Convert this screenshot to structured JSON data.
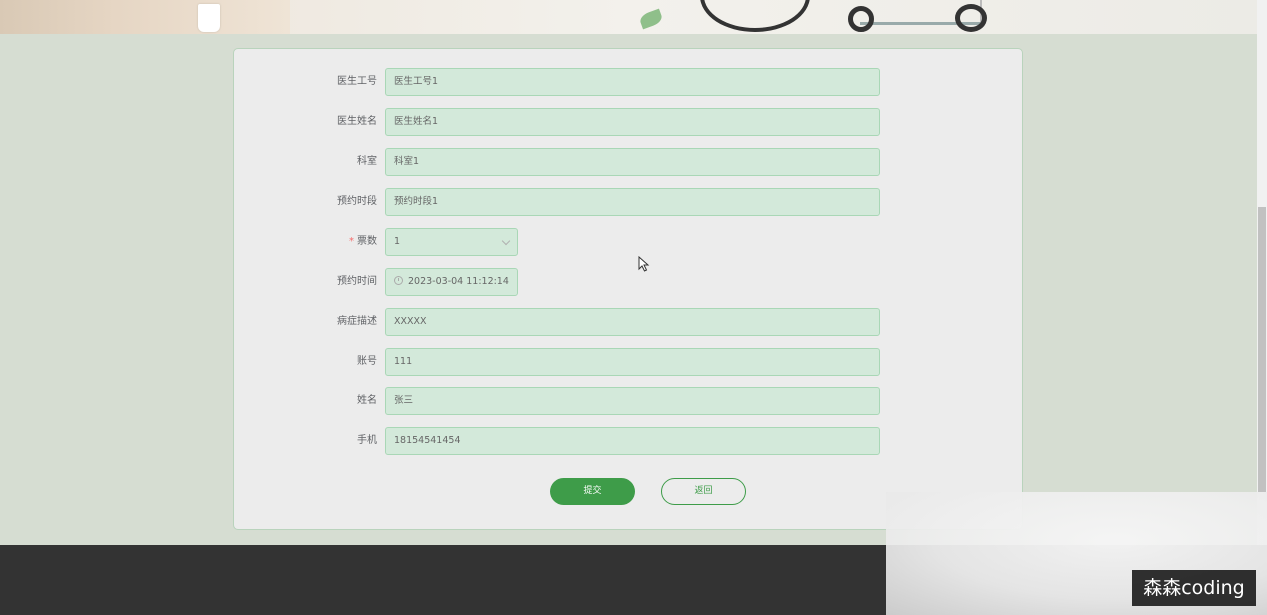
{
  "form": {
    "fields": [
      {
        "label": "医生工号",
        "value": "医生工号1"
      },
      {
        "label": "医生姓名",
        "value": "医生姓名1"
      },
      {
        "label": "科室",
        "value": "科室1"
      },
      {
        "label": "预约时段",
        "value": "预约时段1"
      },
      {
        "label": "票数",
        "value": "1",
        "required": true,
        "type": "select"
      },
      {
        "label": "预约时间",
        "value": "2023-03-04 11:12:14",
        "type": "datetime"
      },
      {
        "label": "病症描述",
        "value": "XXXXX"
      },
      {
        "label": "账号",
        "value": "111"
      },
      {
        "label": "姓名",
        "value": "张三"
      },
      {
        "label": "手机",
        "value": "18154541454"
      }
    ],
    "required_mark": "*",
    "submit_label": "提交",
    "back_label": "返回"
  },
  "icons": {
    "select_toggle": "chevron-down-icon",
    "datetime": "clock-icon",
    "pointer": "mouse-cursor-icon"
  },
  "colors": {
    "accent": "#3e9c49",
    "field_bg": "#d3e9da",
    "field_border": "#a9d7b6",
    "required": "#f56c6c",
    "footer": "#333333"
  },
  "watermark": "森森coding"
}
